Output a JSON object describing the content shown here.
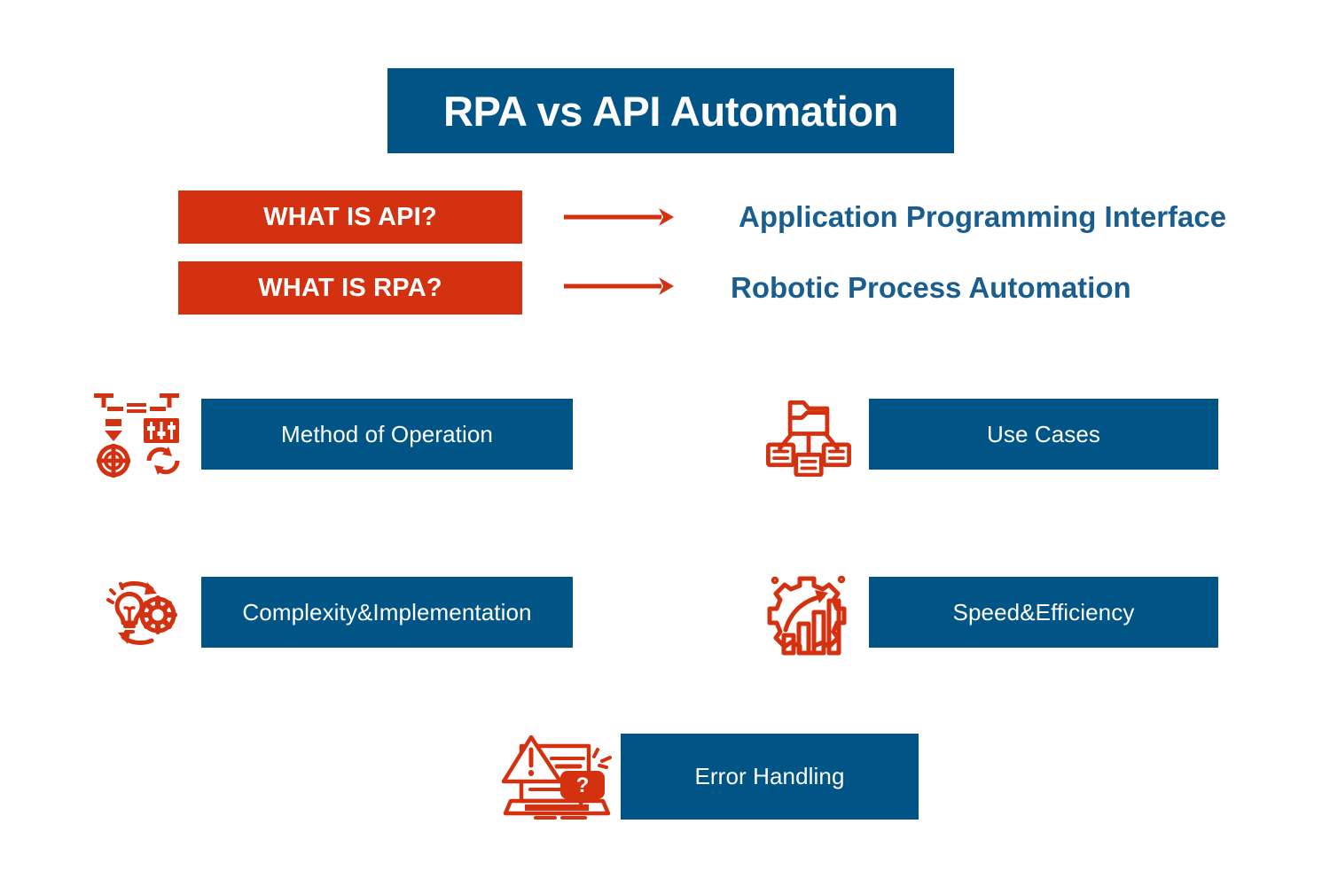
{
  "title": {
    "text": "RPA vs API Automation"
  },
  "colors": {
    "brand_blue": "#015486",
    "accent_red": "#d33110",
    "answer_blue": "#1a5e8f",
    "background": "#ffffff"
  },
  "definitions": [
    {
      "question": "WHAT IS API?",
      "answer": "Application Programming Interface",
      "arrow_icon": "arrow-right-icon"
    },
    {
      "question": "WHAT IS RPA?",
      "answer": "Robotic Process Automation",
      "arrow_icon": "arrow-right-icon"
    }
  ],
  "features": [
    {
      "label": "Method of Operation",
      "icon": "process-controls-icon"
    },
    {
      "label": "Use Cases",
      "icon": "folder-hierarchy-icon"
    },
    {
      "label": "Complexity&Implementation",
      "icon": "lightbulb-gear-cycle-icon"
    },
    {
      "label": "Speed&Efficiency",
      "icon": "gear-bar-chart-growth-icon"
    },
    {
      "label": "Error Handling",
      "icon": "laptop-warning-question-icon"
    }
  ]
}
